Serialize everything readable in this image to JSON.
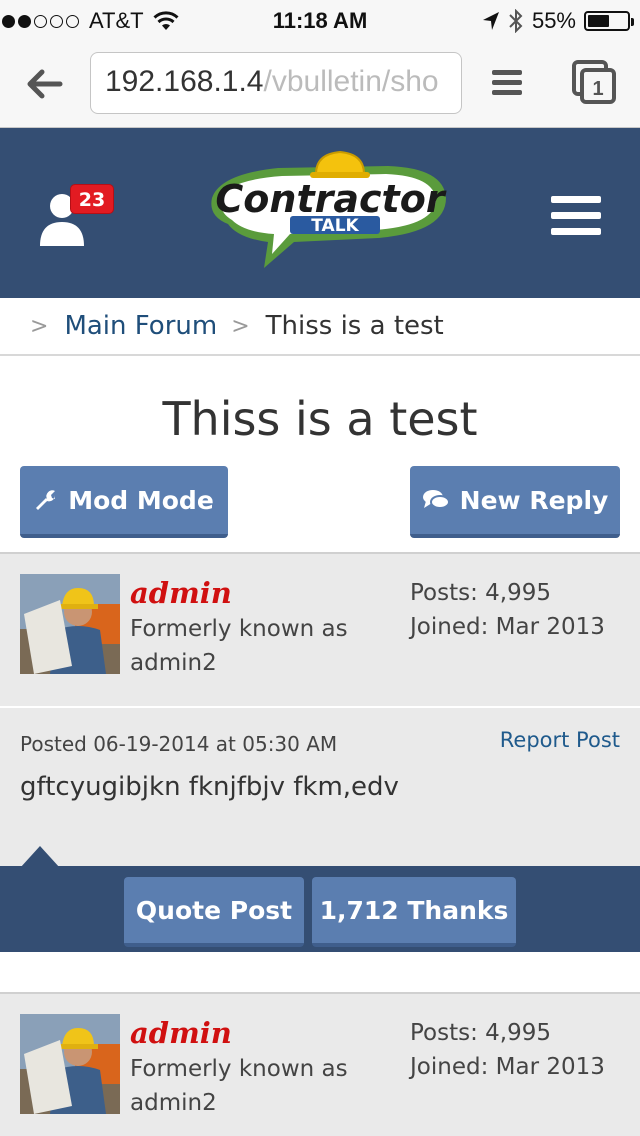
{
  "status_bar": {
    "carrier": "AT&T",
    "time": "11:18 AM",
    "battery": "55%",
    "battery_level": 0.55
  },
  "browser": {
    "url_host": "192.168.1.4",
    "url_path": "/vbulletin/sho",
    "tab_count": "1"
  },
  "header": {
    "notification_count": "23"
  },
  "breadcrumb": {
    "sep": ">",
    "forum": "Main Forum",
    "current": "Thiss is a test"
  },
  "thread": {
    "title": "Thiss is a test",
    "mod_mode_label": "Mod Mode",
    "new_reply_label": "New Reply"
  },
  "post": {
    "username": "admin",
    "user_title": "Formerly known as admin2",
    "posts": "Posts: 4,995",
    "joined": "Joined: Mar 2013",
    "posted": "Posted 06-19-2014 at 05:30 AM",
    "report_label": "Report Post",
    "content": "gftcyugibjkn fknjfbjv fkm,edv",
    "quote_label": "Quote Post",
    "thanks_label": "1,712 Thanks"
  },
  "next_post": {
    "username": "admin",
    "user_title": "Formerly known as admin2",
    "posts": "Posts: 4,995",
    "joined": "Joined: Mar 2013"
  }
}
